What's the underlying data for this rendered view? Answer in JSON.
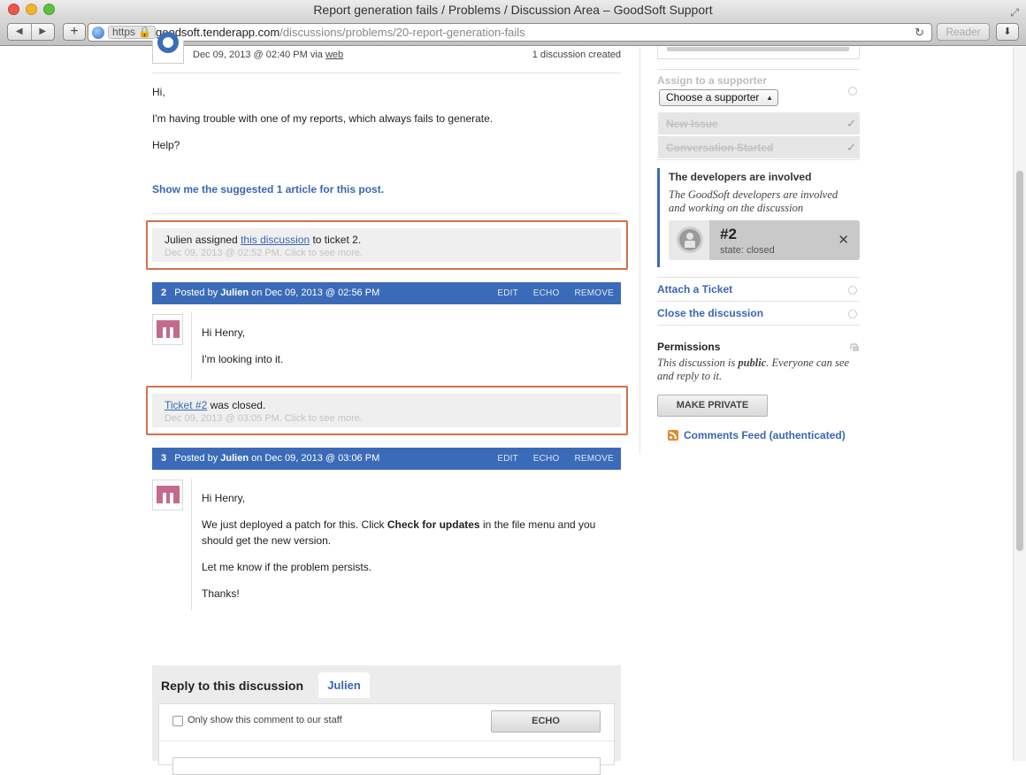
{
  "browser": {
    "window_title": "Report generation fails / Problems / Discussion Area – GoodSoft Support",
    "url_scheme": "https",
    "url_host": "goodsoft.tenderapp.com",
    "url_path": "/discussions/problems/20-report-generation-fails",
    "reader_label": "Reader",
    "add_label": "+"
  },
  "original_post": {
    "meta_prefix": "Dec 09, 2013 @ 02:40 PM via",
    "meta_link": "web",
    "created_count": "1 discussion created",
    "body": [
      "Hi,",
      "I'm having trouble with one of my reports, which always fails to generate.",
      "Help?"
    ],
    "suggested_link": "Show me the suggested 1 article for this post."
  },
  "events": [
    {
      "actor": "Julien assigned",
      "link": "this discussion",
      "suffix": "to ticket 2.",
      "time": "Dec 09, 2013 @ 02:52 PM. Click to see more."
    },
    {
      "link": "Ticket #2",
      "suffix": "was closed.",
      "time": "Dec 09, 2013 @ 03:05 PM. Click to see more."
    }
  ],
  "posts": [
    {
      "number": "2",
      "posted_by": "Posted by",
      "author": "Julien",
      "date": "on Dec 09, 2013 @ 02:56 PM",
      "body": [
        "Hi Henry,",
        "I'm looking into it."
      ]
    },
    {
      "number": "3",
      "posted_by": "Posted by",
      "author": "Julien",
      "date": "on Dec 09, 2013 @ 03:06 PM",
      "body_greeting": "Hi Henry,",
      "body_p1_a": "We just deployed a patch for this. Click",
      "body_p1_bold": "Check for updates",
      "body_p1_b": "in the file menu and you",
      "body_p1_c": "should get the new version.",
      "body_p2": "Let me know if the problem persists.",
      "body_p3": "Thanks!"
    }
  ],
  "post_actions": {
    "edit": "EDIT",
    "echo": "ECHO",
    "remove": "REMOVE"
  },
  "sidebar": {
    "assign_label": "Assign to a supporter",
    "assign_select": "Choose a supporter",
    "step_new_issue": "New Issue",
    "step_conversation": "Conversation Started",
    "dev_title": "The developers are involved",
    "dev_desc": "The GoodSoft developers are involved and working on the discussion",
    "ticket_number": "#2",
    "ticket_state": "state: closed",
    "attach_ticket": "Attach a Ticket",
    "close_discussion": "Close the discussion",
    "permissions_title": "Permissions",
    "perm_desc_a": "This discussion is",
    "perm_desc_bold": "public",
    "perm_desc_b": ". Everyone can see and reply to it.",
    "make_private": "MAKE PRIVATE",
    "comments_feed": "Comments Feed (authenticated)"
  },
  "reply": {
    "title": "Reply to this discussion",
    "tab_user": "Julien",
    "staff_only_label": "Only show this comment to our staff",
    "echo_button": "ECHO"
  },
  "colors": {
    "accent_blue": "#3b6bb8",
    "highlight_frame": "#d2714a",
    "avatar_pink": "#c36a8d"
  }
}
